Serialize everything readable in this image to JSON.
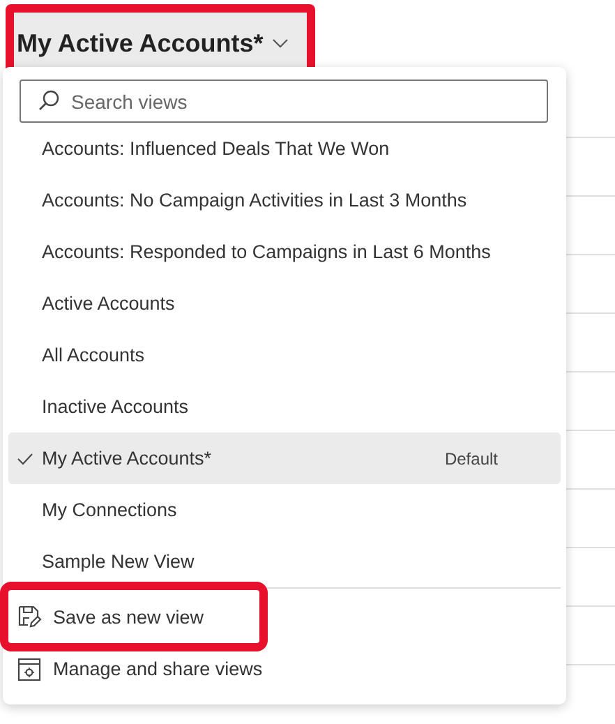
{
  "header": {
    "title": "My Active Accounts*",
    "highlighted": true
  },
  "menu": {
    "search": {
      "placeholder": "Search views"
    },
    "views": [
      {
        "label": "Accounts: Influenced Deals That We Won",
        "selected": false
      },
      {
        "label": "Accounts: No Campaign Activities in Last 3 Months",
        "selected": false
      },
      {
        "label": "Accounts: Responded to Campaigns in Last 6 Months",
        "selected": false
      },
      {
        "label": "Active Accounts",
        "selected": false
      },
      {
        "label": "All Accounts",
        "selected": false
      },
      {
        "label": "Inactive Accounts",
        "selected": false
      },
      {
        "label": "My Active Accounts*",
        "selected": true,
        "badge": "Default"
      },
      {
        "label": "My Connections",
        "selected": false
      },
      {
        "label": "Sample New View",
        "selected": false
      }
    ],
    "actions": [
      {
        "kind": "save",
        "label": "Save as new view",
        "highlighted": true
      },
      {
        "kind": "manage",
        "label": "Manage and share views",
        "highlighted": false
      }
    ]
  }
}
